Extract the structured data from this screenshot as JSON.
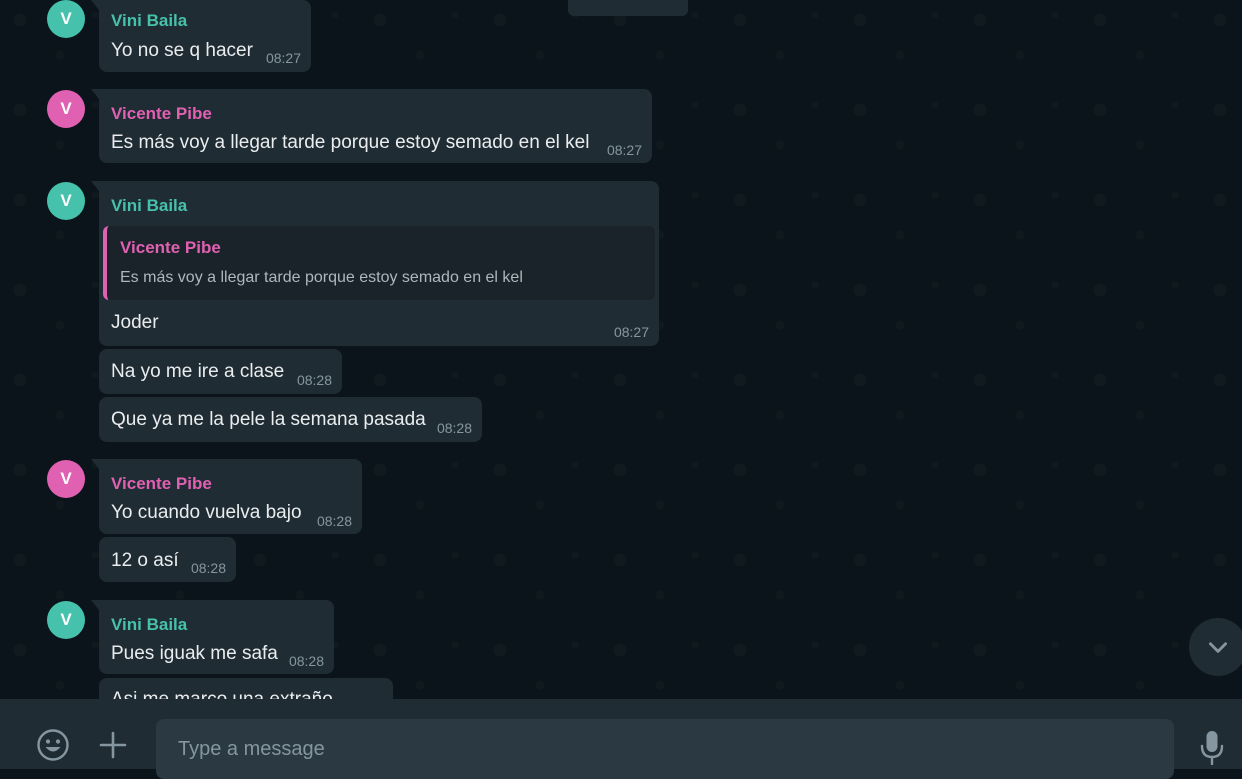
{
  "messages": [
    {
      "sender": "Vini Baila",
      "avatar": "V",
      "text": "Yo no se q hacer",
      "time": "08:27"
    },
    {
      "sender": "Vicente Pibe",
      "avatar": "V",
      "text": "Es más voy a llegar tarde porque estoy semado en el kel",
      "time": "08:27"
    },
    {
      "sender": "Vini Baila",
      "avatar": "V",
      "quote": {
        "sender": "Vicente Pibe",
        "text": "Es más voy a llegar tarde porque estoy semado en el kel"
      },
      "text": "Joder",
      "time": "08:27"
    },
    {
      "text": "Na yo me ire a clase",
      "time": "08:28"
    },
    {
      "text": "Que ya me la pele la semana pasada",
      "time": "08:28"
    },
    {
      "sender": "Vicente Pibe",
      "avatar": "V",
      "text": "Yo cuando vuelva bajo",
      "time": "08:28"
    },
    {
      "text": "12 o así",
      "time": "08:28"
    },
    {
      "sender": "Vini Baila",
      "avatar": "V",
      "text": "Pues iguak me safa",
      "time": "08:28"
    },
    {
      "text": "Asi me marco una extraño"
    }
  ],
  "composer": {
    "placeholder": "Type a message",
    "emoji_icon": "emoji-icon",
    "attach_icon": "plus-icon",
    "mic_icon": "microphone-icon"
  },
  "scroll_down_icon": "chevron-down-icon",
  "colors": {
    "background": "#0b141a",
    "bubble": "#202c33",
    "sender_teal": "#46c1ab",
    "sender_pink": "#e060b2",
    "timestamp": "#8696a0"
  }
}
